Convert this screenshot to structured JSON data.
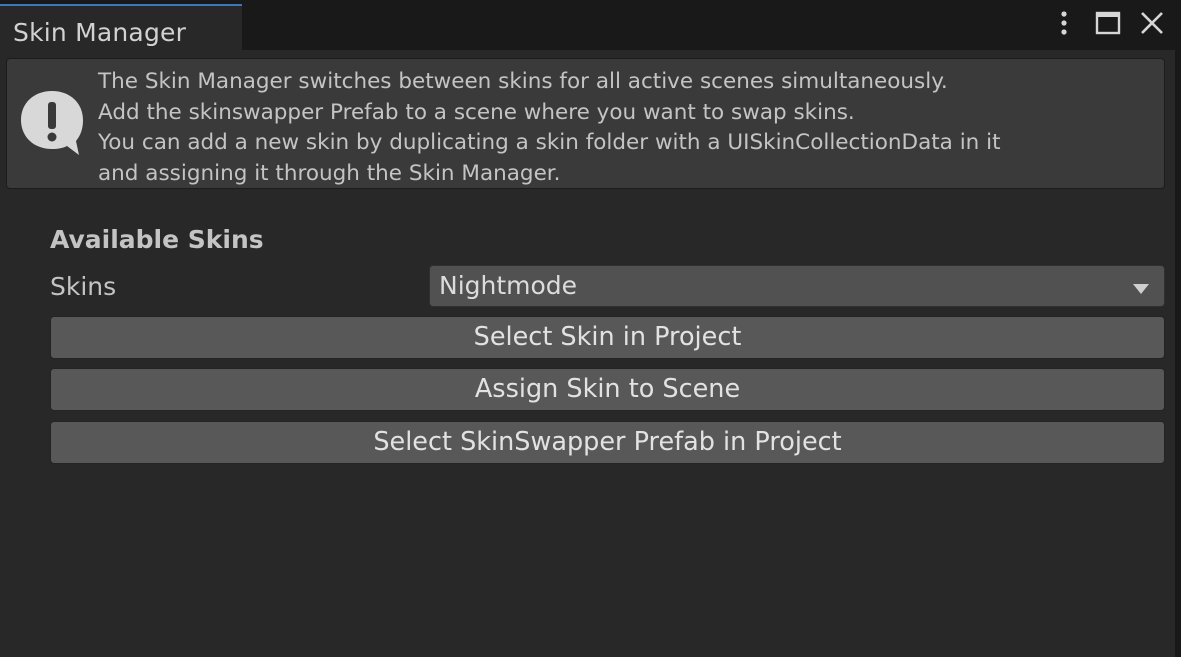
{
  "window": {
    "tab_title": "Skin Manager",
    "controls": [
      {
        "icon": "kebab-menu-icon"
      },
      {
        "icon": "maximize-icon"
      },
      {
        "icon": "close-icon"
      }
    ]
  },
  "help_box": {
    "icon": "warning-speech-bubble-icon",
    "lines": [
      "The Skin Manager switches between skins for all active scenes simultaneously.",
      "Add the skinswapper Prefab to a scene where you want to swap skins.",
      "You can add a new skin by duplicating a skin folder with a UISkinCollectionData in it",
      "and assigning it through the Skin Manager."
    ]
  },
  "available_skins": {
    "header": "Available Skins",
    "skins_label": "Skins",
    "skins_selected": "Nightmode"
  },
  "buttons": {
    "select_skin": "Select Skin in Project",
    "assign_skin": "Assign Skin to Scene",
    "select_prefab": "Select SkinSwapper Prefab in Project"
  },
  "colors": {
    "accent": "#3a79bb",
    "background": "#282828",
    "button": "#585858",
    "text": "#c4c4c4"
  }
}
